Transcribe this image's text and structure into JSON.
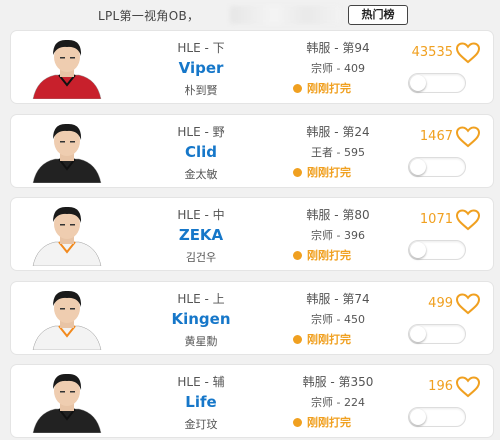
{
  "header": {
    "text": "LPL第一视角OB，",
    "hot_button": "热门榜"
  },
  "colors": {
    "accent_orange": "#f0a020",
    "name_blue": "#1677c9"
  },
  "players": [
    {
      "team_pos": "HLE - 下",
      "id": "Viper",
      "real_name": "朴到賢",
      "server_rank": "韩服 - 第94",
      "tier_points": "宗师 - 409",
      "status": "刚刚打完",
      "count": "43535",
      "toggle_on": false,
      "jersey": "red"
    },
    {
      "team_pos": "HLE - 野",
      "id": "Clid",
      "real_name": "金太敏",
      "server_rank": "韩服 - 第24",
      "tier_points": "王者 - 595",
      "status": "刚刚打完",
      "count": "1467",
      "toggle_on": false,
      "jersey": "black"
    },
    {
      "team_pos": "HLE - 中",
      "id": "ZEKA",
      "real_name": "김건우",
      "server_rank": "韩服 - 第80",
      "tier_points": "宗师 - 396",
      "status": "刚刚打完",
      "count": "1071",
      "toggle_on": false,
      "jersey": "white"
    },
    {
      "team_pos": "HLE - 上",
      "id": "Kingen",
      "real_name": "黄星勳",
      "server_rank": "韩服 - 第74",
      "tier_points": "宗师 - 450",
      "status": "刚刚打完",
      "count": "499",
      "toggle_on": false,
      "jersey": "white"
    },
    {
      "team_pos": "HLE - 辅",
      "id": "Life",
      "real_name": "金玎玟",
      "server_rank": "韩服 - 第350",
      "tier_points": "宗师 - 224",
      "status": "刚刚打完",
      "count": "196",
      "toggle_on": false,
      "jersey": "black"
    }
  ]
}
